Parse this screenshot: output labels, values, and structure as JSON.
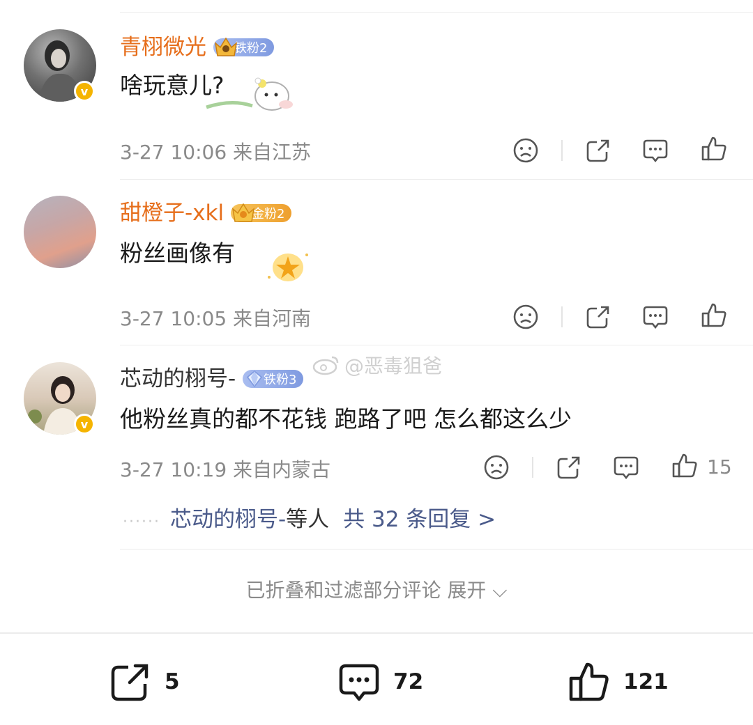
{
  "comments": [
    {
      "username": "青栩微光",
      "badge": "铁粉2",
      "text": "啥玩意儿?",
      "meta": "3-27 10:06  来自江苏",
      "likes": ""
    },
    {
      "username": "甜橙子-xkl",
      "badge": "金粉2",
      "text": "粉丝画像有",
      "meta": "3-27 10:05  来自河南",
      "likes": ""
    },
    {
      "username": "芯动的栩号-",
      "badge": "铁粉3",
      "text": "他粉丝真的都不花钱 跑路了吧 怎么都这么少",
      "meta": "3-27 10:19  来自内蒙古",
      "likes": "15"
    }
  ],
  "replies": {
    "dots": "······",
    "who": "芯动的栩号-",
    "suffix": "等人",
    "count_text": "共 32 条回复 >"
  },
  "watermark": "@恶毒狙爸",
  "folded_text": "已折叠和过滤部分评论 展开 ⌵",
  "bottom_bar": {
    "share_count": "5",
    "comment_count": "72",
    "like_count": "121"
  },
  "colors": {
    "username_highlight": "#e66e1b",
    "link": "#4a5a8a",
    "iron_badge": "#8fa8e6",
    "gold_badge": "#f2b84b"
  }
}
